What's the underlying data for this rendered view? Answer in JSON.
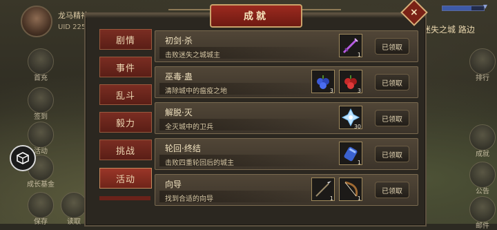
{
  "player": {
    "name": "龙马精神",
    "uid": "UID  2253"
  },
  "location": "迷失之城 路边",
  "left_menu": [
    "首充",
    "签到",
    "活动",
    "成长基金",
    "保存",
    "读取"
  ],
  "right_menu": [
    "排行",
    "成就",
    "公告",
    "邮件"
  ],
  "dialog": {
    "title": "成就"
  },
  "tabs": [
    "剧情",
    "事件",
    "乱斗",
    "毅力",
    "挑战",
    "活动"
  ],
  "active_tab": "活动",
  "achievements": [
    {
      "name": "初剑·杀",
      "desc": "击败迷失之城城主",
      "status": "已领取",
      "rewards": [
        {
          "icon": "purple-sword-icon",
          "qty": "1"
        }
      ]
    },
    {
      "name": "巫毒·蛊",
      "desc": "清除城中的瘟疫之地",
      "status": "已领取",
      "rewards": [
        {
          "icon": "blue-berries-icon",
          "qty": "3"
        },
        {
          "icon": "red-berries-icon",
          "qty": "3"
        }
      ]
    },
    {
      "name": "解脱·灭",
      "desc": "全灭城中的卫兵",
      "status": "已领取",
      "rewards": [
        {
          "icon": "ice-crystal-icon",
          "qty": "30"
        }
      ]
    },
    {
      "name": "轮回·终结",
      "desc": "击败四重轮回后的城主",
      "status": "已领取",
      "rewards": [
        {
          "icon": "blue-scroll-icon",
          "qty": "1"
        }
      ]
    },
    {
      "name": "向导",
      "desc": "找到合适的向导",
      "status": "已领取",
      "rewards": [
        {
          "icon": "spear-icon",
          "qty": "1"
        },
        {
          "icon": "bow-icon",
          "qty": "1"
        }
      ]
    }
  ]
}
